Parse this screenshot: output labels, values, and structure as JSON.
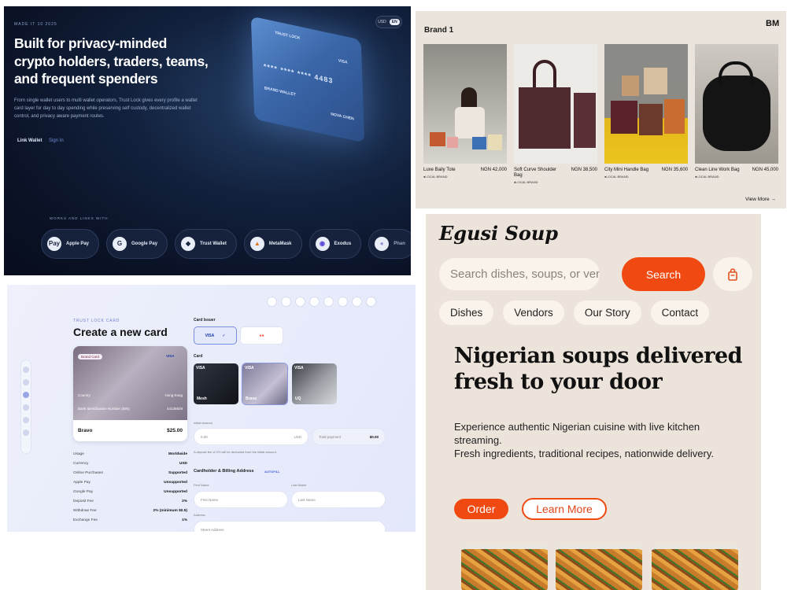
{
  "crypto": {
    "kicker": "MADE IT 10 2025",
    "lang": {
      "left": "USD",
      "active": "EN"
    },
    "headline": "Built for privacy-minded crypto holders, traders, teams, and frequent spenders",
    "subtext": "From single wallet users to multi wallet operators, Trust Lock gives every profile a wallet card layer for day to day spending while preserving self custody, decentralized wallet control, and privacy aware payment routes.",
    "link_wallet": "Link Wallet",
    "sign_in": "Sign In",
    "card": {
      "brand": "TRUST LOCK",
      "network": "VISA",
      "number": "**** **** **** 4483",
      "label": "BRAND WALLET",
      "holder": "NOVA CHEN"
    },
    "works_label": "WORKS AND LINKS WITH",
    "partners": [
      {
        "name": "Apple Pay",
        "icon": "apple-icon",
        "glyph": "Pay"
      },
      {
        "name": "Google Pay",
        "icon": "google-icon",
        "glyph": "G"
      },
      {
        "name": "Trust Wallet",
        "icon": "shield-icon",
        "glyph": "◆"
      },
      {
        "name": "MetaMask",
        "icon": "fox-icon",
        "glyph": "▲"
      },
      {
        "name": "Exodus",
        "icon": "exodus-icon",
        "glyph": "◉"
      },
      {
        "name": "Phan",
        "icon": "phantom-icon",
        "glyph": "●"
      }
    ]
  },
  "brand": {
    "title": "Brand 1",
    "logo": "BM",
    "products": [
      {
        "name": "Luxe Baily Tote",
        "price": "NGN 42,000",
        "tag": "LOCAL BRAND"
      },
      {
        "name": "Soft Curve Shoulder Bag",
        "price": "NGN 38,500",
        "tag": "LOCAL BRAND"
      },
      {
        "name": "City Mini Handle Bag",
        "price": "NGN 35,600",
        "tag": "LOCAL BRAND"
      },
      {
        "name": "Clean Line Work Bag",
        "price": "NGN 45,000",
        "tag": "LOCAL BRAND"
      }
    ],
    "view_more": "View More →"
  },
  "create_card": {
    "kicker": "TRUST LOCK CARD",
    "title": "Create a new card",
    "card_preview": {
      "label": "Brand Card",
      "network": "VISA",
      "country_label": "Country",
      "country": "Hong Kong",
      "bin_label": "Bank Identification Number (BIN)",
      "bin": "44135829",
      "name": "Bravo",
      "amount": "$25.00"
    },
    "specs": [
      {
        "label": "Usage",
        "value": "Worldwide"
      },
      {
        "label": "Currency",
        "value": "USD"
      },
      {
        "label": "Online Purchases",
        "value": "Supported"
      },
      {
        "label": "Apple Pay",
        "value": "Unsupported"
      },
      {
        "label": "Google Pay",
        "value": "Unsupported"
      },
      {
        "label": "Deposit Fee",
        "value": "2%"
      },
      {
        "label": "Withdraw Fee",
        "value": "2% (minimum $0.5)"
      },
      {
        "label": "Exchange Fee",
        "value": "1%"
      }
    ],
    "card_issuer_label": "Card Issuer",
    "issuers": [
      "VISA",
      "●●"
    ],
    "card_label": "Card",
    "designs": [
      {
        "name": "Mesh",
        "badge": "VISA"
      },
      {
        "name": "Bravo",
        "badge": "VISA"
      },
      {
        "name": "UQ",
        "badge": "VISA"
      }
    ],
    "initial_amount_label": "Initial amount",
    "amount_placeholder": "0.00",
    "amount_currency": "USD",
    "total_label": "Total payment",
    "total_value": "$0.00",
    "note": "A deposit fee of 2% will be deducted from the initial amount.",
    "billing_title": "Cardholder & Billing Address",
    "autofill": "AUTOFILL",
    "first_name_label": "First Name",
    "first_name_placeholder": "First Name",
    "last_name_label": "Last Name",
    "last_name_placeholder": "Last Name",
    "address_label": "Address",
    "address_placeholder": "Street Address"
  },
  "egusi": {
    "logo": "Egusi Soup",
    "search_placeholder": "Search dishes, soups, or vendors",
    "search_button": "Search",
    "nav": [
      "Dishes",
      "Vendors",
      "Our Story",
      "Contact"
    ],
    "headline": "Nigerian soups delivered fresh to your door",
    "desc_line1": "Experience authentic Nigerian cuisine with live kitchen streaming.",
    "desc_line2": "Fresh ingredients, traditional recipes, nationwide delivery.",
    "order": "Order",
    "learn_more": "Learn More"
  },
  "colors": {
    "crypto_bg": "#0a1226",
    "accent_orange": "#f04a12",
    "brand_bg": "#ebe4dc",
    "card_panel_bg": "#e8ecfb"
  }
}
